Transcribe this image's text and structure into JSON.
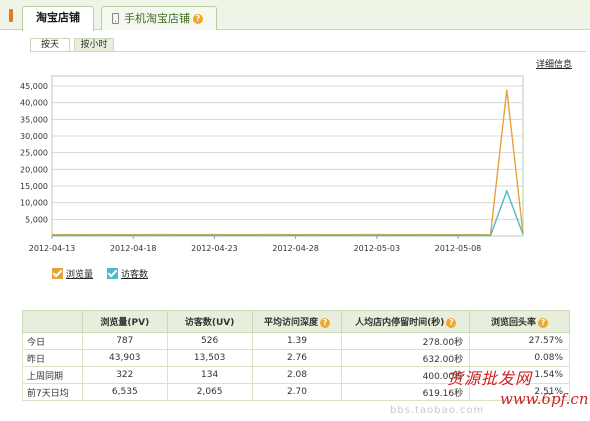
{
  "tabs": {
    "active": "淘宝店铺",
    "mobile": "手机淘宝店铺",
    "mobile_help": "?"
  },
  "subtabs": {
    "by_day": "按天",
    "by_hour": "按小时"
  },
  "detail_link": "详细信息",
  "chart_data": {
    "type": "line",
    "y_ticks": [
      "45,000",
      "40,000",
      "35,000",
      "30,000",
      "25,000",
      "20,000",
      "15,000",
      "10,000",
      "5,000"
    ],
    "x_tick_labels": [
      "2012-04-13",
      "2012-04-18",
      "2012-04-23",
      "2012-04-28",
      "2012-05-03",
      "2012-05-08"
    ],
    "x": [
      "2012-04-13",
      "2012-04-14",
      "2012-04-15",
      "2012-04-16",
      "2012-04-17",
      "2012-04-18",
      "2012-04-19",
      "2012-04-20",
      "2012-04-21",
      "2012-04-22",
      "2012-04-23",
      "2012-04-24",
      "2012-04-25",
      "2012-04-26",
      "2012-04-27",
      "2012-04-28",
      "2012-04-29",
      "2012-04-30",
      "2012-05-01",
      "2012-05-02",
      "2012-05-03",
      "2012-05-04",
      "2012-05-05",
      "2012-05-06",
      "2012-05-07",
      "2012-05-08",
      "2012-05-09",
      "2012-05-10",
      "2012-05-11",
      "2012-05-12"
    ],
    "ylim": [
      0,
      48000
    ],
    "grid": true,
    "series": [
      {
        "name": "浏览量",
        "color": "#e8a23a",
        "values": [
          400,
          420,
          380,
          410,
          390,
          400,
          420,
          410,
          390,
          400,
          410,
          400,
          390,
          410,
          420,
          400,
          410,
          390,
          400,
          420,
          410,
          400,
          390,
          410,
          400,
          400,
          420,
          320,
          43903,
          787
        ]
      },
      {
        "name": "访客数",
        "color": "#4fb8c9",
        "values": [
          150,
          160,
          140,
          150,
          155,
          150,
          160,
          150,
          145,
          150,
          155,
          150,
          145,
          150,
          160,
          150,
          155,
          145,
          150,
          160,
          155,
          150,
          145,
          150,
          150,
          150,
          160,
          134,
          13503,
          526
        ]
      }
    ],
    "legend_position": "bottom-left"
  },
  "legend": {
    "pv_label": "浏览量",
    "uv_label": "访客数",
    "pv_color": "#e8a23a",
    "uv_color": "#4fb8c9"
  },
  "table": {
    "headers": [
      "",
      "浏览量(PV)",
      "访客数(UV)",
      "平均访问深度",
      "人均店内停留时间(秒)",
      "浏览回头率"
    ],
    "rows": [
      [
        "今日",
        "787",
        "526",
        "1.39",
        "278.00秒",
        "27.57%"
      ],
      [
        "昨日",
        "43,903",
        "13,503",
        "2.76",
        "632.00秒",
        "0.08%"
      ],
      [
        "上周同期",
        "322",
        "134",
        "2.08",
        "400.00秒",
        "1.54%"
      ],
      [
        "前7天日均",
        "6,535",
        "2,065",
        "2.70",
        "619.16秒",
        "2.51%"
      ]
    ]
  },
  "watermark": {
    "line1": "货源批发网",
    "line2": "www.6pf.cn",
    "line3": "bbs.taobao.com"
  }
}
